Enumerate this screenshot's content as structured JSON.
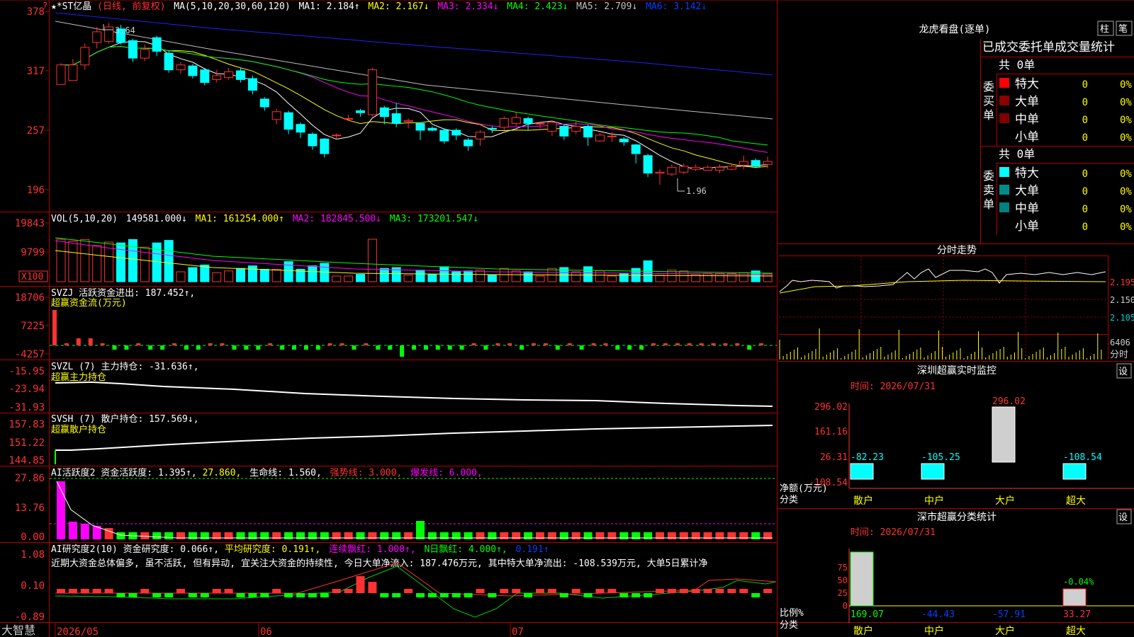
{
  "stock": {
    "name": "★*ST亿晶",
    "period": "(日线, 前复权)",
    "brand": "大智慧"
  },
  "colors": {
    "up": "#ff3232",
    "down": "#00ffff",
    "ma1": "#ffffff",
    "ma2": "#ffff00",
    "ma3": "#ff00ff",
    "ma4": "#00ff00",
    "ma5": "#c0c0c0",
    "ma6": "#0000ff",
    "grid": "#a00000"
  },
  "main": {
    "header": {
      "ma_label": "MA(5,10,20,30,60,120)",
      "ma1": "MA1: 2.184↑",
      "ma2": "MA2: 2.167↓",
      "ma3": "MA3: 2.334↓",
      "ma4": "MA4: 2.423↓",
      "ma5": "MA5: 2.709↓",
      "ma6": "MA6: 3.142↓"
    },
    "yticks": [
      "378",
      "317",
      "257",
      "196"
    ],
    "high_label": "3.64",
    "low_label": "1.96"
  },
  "vol": {
    "header": "VOL(5,10,20)",
    "v": "149581.000↓",
    "ma1": "MA1: 161254.000↑",
    "ma2": "MA2: 182845.500↓",
    "ma3": "MA3: 173201.547↓",
    "yticks": [
      "19843",
      "9799"
    ],
    "unit": "X100"
  },
  "svzj": {
    "header": "SVZJ  活跃资金进出: 187.452↑,",
    "sub": "超赢资金流(万元)",
    "yticks": [
      "18706",
      "7225",
      "-4257"
    ]
  },
  "svzl": {
    "header": "SVZL (7) 主力持仓: -31.636↑,",
    "sub": "超赢主力持仓",
    "yticks": [
      "-15.95",
      "-23.94",
      "-31.93"
    ]
  },
  "svsh": {
    "header": "SVSH (7) 散户持仓: 157.569↓,",
    "sub": "超赢散户持仓",
    "yticks": [
      "157.83",
      "151.22",
      "144.85"
    ]
  },
  "aihy": {
    "header_a": "AI活跃度2 资金活跃度: 1.395↑,",
    "header_b": "27.860,",
    "header_c": "生命线: 1.560,",
    "header_d": "强势线: 3.000,",
    "header_e": "爆发线: 6.000,",
    "yticks": [
      "27.86",
      "13.76",
      "0.00"
    ]
  },
  "aiyj": {
    "header_a": "AI研究度2(10) 资金研究度: 0.066↑,",
    "header_b": "平均研究度: 0.191↑,",
    "header_c": "连续飘红: 1.000↑,",
    "header_d": "N日飘红: 4.000↑,",
    "header_e": "0.191↑",
    "text": "近期大资金总体偏多, 虽不活跃, 但有异动, 宜关注大资金的持续性, 今日大单净流入: 187.476万元, 其中特大单净流出: -108.539万元, 大单5日累计净",
    "yticks": [
      "1.08",
      "0.10",
      "-0.89"
    ]
  },
  "xaxis": {
    "labels": [
      "2026/05",
      "06",
      "07"
    ]
  },
  "right": {
    "title": "龙虎看盘(逐单)",
    "btn1": "柱",
    "btn2": "笔",
    "stat_title": "已成交委托单成交量统计",
    "buy": {
      "side": "委买单",
      "total": "共 0单",
      "rows": [
        {
          "name": "特大",
          "v": "0",
          "p": "0%"
        },
        {
          "name": "大单",
          "v": "0",
          "p": "0%"
        },
        {
          "name": "中单",
          "v": "0",
          "p": "0%"
        },
        {
          "name": "小单",
          "v": "0",
          "p": "0%"
        }
      ]
    },
    "sell": {
      "side": "委卖单",
      "total": "共 0单",
      "rows": [
        {
          "name": "特大",
          "v": "0",
          "p": "0%"
        },
        {
          "name": "大单",
          "v": "0",
          "p": "0%"
        },
        {
          "name": "中单",
          "v": "0",
          "p": "0%"
        },
        {
          "name": "小单",
          "v": "0",
          "p": "0%"
        }
      ]
    },
    "fenshi": {
      "title": "分时走势",
      "yticks": [
        "2.195",
        "2.150",
        "2.105"
      ],
      "vol_label": "6406",
      "unit": "分时"
    },
    "sz_monitor": {
      "title": "深圳超赢实时监控",
      "btn": "设",
      "time": "时间: 2026/07/31",
      "yticks": [
        "296.02",
        "161.16",
        "26.31",
        "-108.54"
      ],
      "ylabel": "净额(万元)",
      "cat_label": "分类",
      "categories": [
        "散户",
        "中户",
        "大户",
        "超大"
      ],
      "values": [
        -82.23,
        -105.25,
        296.02,
        -108.54
      ],
      "value_labels": [
        "-82.23",
        "-105.25",
        "296.02",
        "-108.54"
      ]
    },
    "sz_class": {
      "title": "深市超赢分类统计",
      "btn": "设",
      "time": "时间: 2026/07/31",
      "yticks": [
        "75",
        "50",
        "25",
        "0"
      ],
      "ylabel": "比例%",
      "cat_label": "分类",
      "categories": [
        "散户",
        "中户",
        "大户",
        "超大"
      ],
      "values": [
        169.07,
        -44.43,
        -57.91,
        33.27
      ],
      "value_labels": [
        "169.07",
        "-44.43",
        "-57.91",
        "33.27"
      ],
      "top_label": "-0.04%"
    }
  },
  "chart_data": {
    "type": "candlestick",
    "title": "★*ST亿晶 (日线, 前复权)",
    "note": "price values shown in 0.01 yuan units per the axis labels",
    "ylim": [
      185,
      385
    ],
    "candles": [
      [
        303,
        323,
        321,
        325
      ],
      [
        307,
        323,
        318,
        329
      ],
      [
        323,
        341,
        318,
        345
      ],
      [
        346,
        357,
        340,
        362
      ],
      [
        347,
        362,
        345,
        366
      ],
      [
        360,
        346,
        344,
        364
      ],
      [
        348,
        330,
        326,
        350
      ],
      [
        330,
        339,
        327,
        344
      ],
      [
        351,
        337,
        332,
        353
      ],
      [
        335,
        318,
        315,
        338
      ],
      [
        318,
        323,
        314,
        326
      ],
      [
        322,
        312,
        309,
        324
      ],
      [
        318,
        305,
        302,
        320
      ],
      [
        308,
        312,
        305,
        318
      ],
      [
        310,
        316,
        308,
        320
      ],
      [
        317,
        308,
        305,
        320
      ],
      [
        309,
        297,
        293,
        312
      ],
      [
        288,
        280,
        276,
        290
      ],
      [
        267,
        275,
        262,
        278
      ],
      [
        274,
        257,
        252,
        276
      ],
      [
        262,
        254,
        248,
        264
      ],
      [
        252,
        240,
        236,
        254
      ],
      [
        247,
        232,
        228,
        248
      ],
      [
        251,
        251,
        247,
        253
      ],
      [
        268,
        268,
        266,
        272
      ],
      [
        276,
        274,
        270,
        278
      ],
      [
        272,
        318,
        270,
        320
      ],
      [
        279,
        270,
        262,
        281
      ],
      [
        273,
        263,
        259,
        284
      ],
      [
        265,
        266,
        258,
        268
      ],
      [
        263,
        256,
        246,
        264
      ],
      [
        258,
        256,
        255,
        260
      ],
      [
        256,
        245,
        242,
        258
      ],
      [
        256,
        251,
        246,
        258
      ],
      [
        246,
        240,
        235,
        248
      ],
      [
        247,
        254,
        240,
        256
      ],
      [
        258,
        257,
        253,
        260
      ],
      [
        259,
        268,
        256,
        270
      ],
      [
        263,
        269,
        260,
        275
      ],
      [
        268,
        263,
        256,
        270
      ],
      [
        263,
        263,
        258,
        265
      ],
      [
        255,
        264,
        250,
        266
      ],
      [
        260,
        250,
        246,
        262
      ],
      [
        255,
        260,
        252,
        265
      ],
      [
        260,
        249,
        240,
        262
      ],
      [
        245,
        251,
        244,
        253
      ],
      [
        250,
        250,
        244,
        254
      ],
      [
        247,
        244,
        240,
        249
      ],
      [
        241,
        232,
        222,
        242
      ],
      [
        230,
        212,
        208,
        232
      ],
      [
        212,
        213,
        200,
        216
      ],
      [
        211,
        218,
        209,
        221
      ],
      [
        213,
        219,
        211,
        222
      ],
      [
        216,
        218,
        214,
        221
      ],
      [
        215,
        218,
        215,
        220
      ],
      [
        215,
        218,
        212,
        221
      ],
      [
        216,
        219,
        215,
        222
      ],
      [
        220,
        224,
        216,
        230
      ],
      [
        225,
        219,
        217,
        227
      ],
      [
        221,
        224,
        217,
        229
      ]
    ]
  }
}
